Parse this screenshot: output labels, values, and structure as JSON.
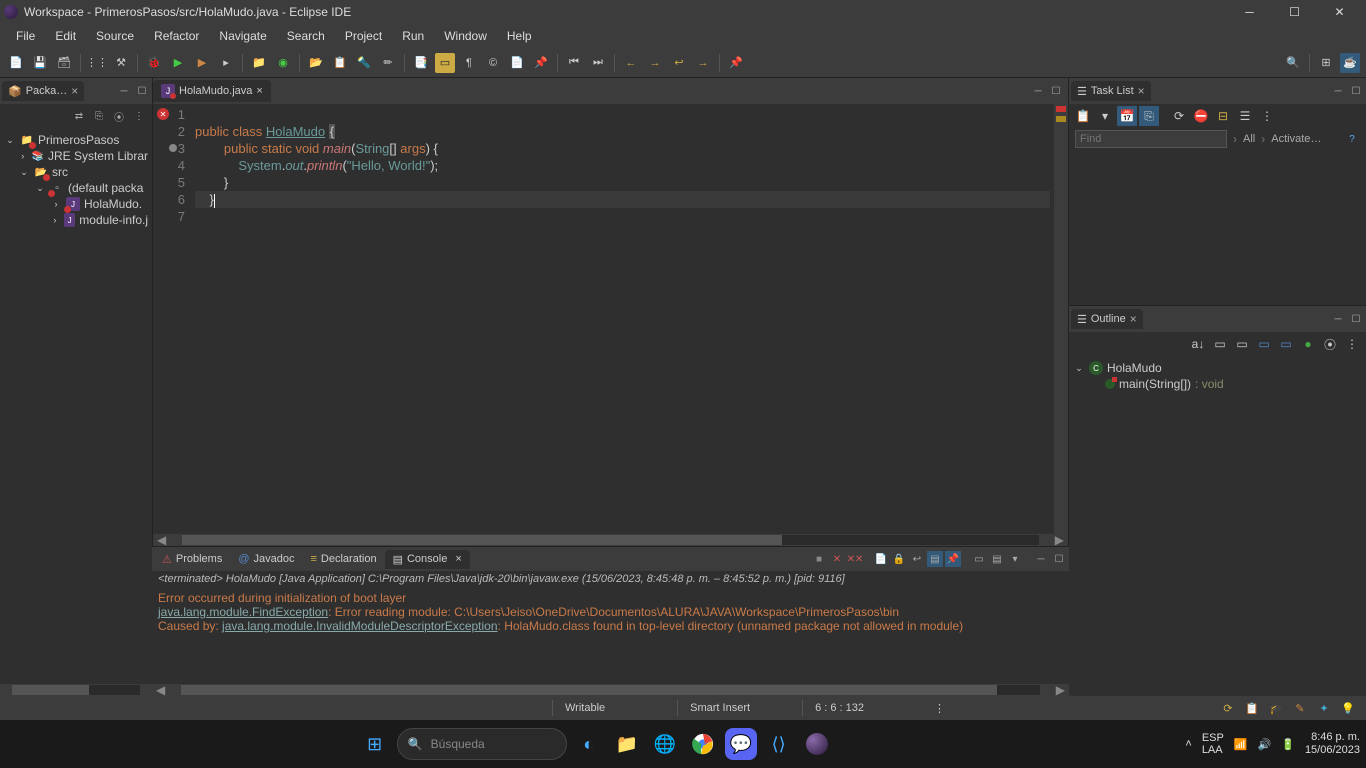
{
  "window": {
    "title": "Workspace - PrimerosPasos/src/HolaMudo.java - Eclipse IDE"
  },
  "menus": [
    "File",
    "Edit",
    "Source",
    "Refactor",
    "Navigate",
    "Search",
    "Project",
    "Run",
    "Window",
    "Help"
  ],
  "package_explorer": {
    "tab": "Packa…",
    "project": "PrimerosPasos",
    "items": [
      {
        "level": 1,
        "label": "JRE System Librar",
        "icon": "lib",
        "arrow": "›"
      },
      {
        "level": 1,
        "label": "src",
        "icon": "src",
        "arrow": "⌄"
      },
      {
        "level": 2,
        "label": "(default packa",
        "icon": "pkg",
        "arrow": "⌄",
        "error": true
      },
      {
        "level": 3,
        "label": "HolaMudo.",
        "icon": "java",
        "arrow": "›",
        "error": true
      },
      {
        "level": 3,
        "label": "module-info.j",
        "icon": "java",
        "arrow": "›"
      }
    ]
  },
  "editor": {
    "tab": "HolaMudo.java",
    "lines": [
      "1",
      "2",
      "3",
      "4",
      "5",
      "6",
      "7"
    ],
    "code": {
      "l2_kw1": "public",
      "l2_kw2": "class",
      "l2_cls": "HolaMudo",
      "l2_brace": "{",
      "l3_kw": "public static void",
      "l3_m": "main",
      "l3_p1": "(",
      "l3_type": "String",
      "l3_arr": "[]",
      "l3_arg": "args",
      "l3_p2": ") {",
      "l4_sys": "System",
      "l4_dot1": ".",
      "l4_out": "out",
      "l4_dot2": ".",
      "l4_pr": "println",
      "l4_p1": "(",
      "l4_str": "\"Hello, World!\"",
      "l4_p2": ");",
      "l5": "}",
      "l6": "}"
    }
  },
  "task_list": {
    "tab": "Task List",
    "find_placeholder": "Find",
    "all": "All",
    "activate": "Activate…"
  },
  "outline": {
    "tab": "Outline",
    "class": "HolaMudo",
    "method": "main(String[])",
    "returns": ": void"
  },
  "bottom": {
    "tabs": {
      "problems": "Problems",
      "javadoc": "Javadoc",
      "declaration": "Declaration",
      "console": "Console"
    },
    "console_header": "<terminated> HolaMudo [Java Application] C:\\Program Files\\Java\\jdk-20\\bin\\javaw.exe  (15/06/2023, 8:45:48 p. m. – 8:45:52 p. m.) [pid: 9116]",
    "console_lines": {
      "l1": "Error occurred during initialization of boot layer",
      "l2_link": "java.lang.module.FindException",
      "l2_rest": ": Error reading module: C:\\Users\\Jeiso\\OneDrive\\Documentos\\ALURA\\JAVA\\Workspace\\PrimerosPasos\\bin",
      "l3_prefix": "Caused by: ",
      "l3_link": "java.lang.module.InvalidModuleDescriptorException",
      "l3_rest": ": HolaMudo.class found in top-level directory (unnamed package not allowed in module)"
    }
  },
  "status": {
    "writable": "Writable",
    "insert": "Smart Insert",
    "cursor": "6 : 6 : 132"
  },
  "taskbar": {
    "search_placeholder": "Búsqueda",
    "lang1": "ESP",
    "lang2": "LAA",
    "time": "8:46 p. m.",
    "date": "15/06/2023"
  }
}
